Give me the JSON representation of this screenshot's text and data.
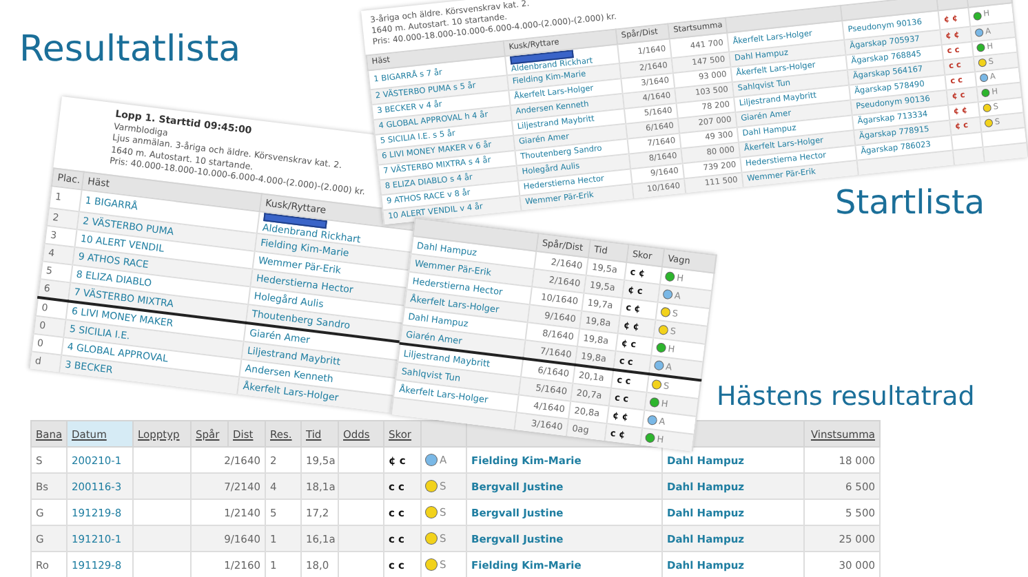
{
  "resultatlista": {
    "title": "Resultatlista",
    "race_title": "Lopp 1. Starttid 09:45:00",
    "details": [
      "Varmblodiga",
      "Ljus anmälan. 3-åriga och äldre. Körsvenskrav kat. 2.",
      "1640 m. Autostart. 10 startande.",
      "Pris: 40.000-18.000-10.000-6.000-4.000-(2.000)-(2.000) kr."
    ],
    "columns": [
      "Plac.",
      "Häst",
      "Kusk/Ryttare"
    ],
    "right_columns": [
      "Spår/Dist",
      "Tid",
      "Skor",
      "Vagn"
    ],
    "rows": [
      {
        "plac": "1",
        "horse": "1 BIGARRÅ",
        "driver": "Aldenbrand Rickhart",
        "marked": true,
        "separator": false,
        "trainer": "Dahl Hampuz",
        "post": "2/1640",
        "time": "19,5a",
        "shoes": "c ¢",
        "cart": {
          "letter": "H",
          "color": "#2db52d"
        }
      },
      {
        "plac": "2",
        "horse": "2 VÄSTERBO PUMA",
        "driver": "Fielding Kim-Marie",
        "marked": false,
        "separator": false,
        "trainer": "Wemmer Pär-Erik",
        "post": "2/1640",
        "time": "19,5a",
        "shoes": "¢ c",
        "cart": {
          "letter": "A",
          "color": "#7ab8e6"
        }
      },
      {
        "plac": "3",
        "horse": "10 ALERT VENDIL",
        "driver": "Wemmer Pär-Erik",
        "marked": false,
        "separator": false,
        "trainer": "Hederstierna Hector",
        "post": "10/1640",
        "time": "19,7a",
        "shoes": "c ¢",
        "cart": {
          "letter": "S",
          "color": "#f2d21b"
        }
      },
      {
        "plac": "4",
        "horse": "9 ATHOS RACE",
        "driver": "Hederstierna Hector",
        "marked": false,
        "separator": false,
        "trainer": "Åkerfelt Lars-Holger",
        "post": "9/1640",
        "time": "19,8a",
        "shoes": "¢ ¢",
        "cart": {
          "letter": "S",
          "color": "#f2d21b"
        }
      },
      {
        "plac": "5",
        "horse": "8 ELIZA DIABLO",
        "driver": "Holegård Aulis",
        "marked": false,
        "separator": false,
        "trainer": "Dahl Hampuz",
        "post": "8/1640",
        "time": "19,8a",
        "shoes": "¢ c",
        "cart": {
          "letter": "H",
          "color": "#2db52d"
        }
      },
      {
        "plac": "6",
        "horse": "7 VÄSTERBO MIXTRA",
        "driver": "Thoutenberg Sandro",
        "marked": false,
        "separator": false,
        "trainer": "Giarén Amer",
        "post": "7/1640",
        "time": "19,8a",
        "shoes": "c c",
        "cart": {
          "letter": "A",
          "color": "#7ab8e6"
        }
      },
      {
        "plac": "0",
        "horse": "6 LIVI MONEY MAKER",
        "driver": "Giarén Amer",
        "marked": false,
        "separator": true,
        "trainer": "Liljestrand Maybritt",
        "post": "6/1640",
        "time": "20,1a",
        "shoes": "c c",
        "cart": {
          "letter": "S",
          "color": "#f2d21b"
        }
      },
      {
        "plac": "0",
        "horse": "5 SICILIA I.E.",
        "driver": "Liljestrand Maybritt",
        "marked": false,
        "separator": false,
        "trainer": "Sahlqvist Tun",
        "post": "5/1640",
        "time": "20,7a",
        "shoes": "c c",
        "cart": {
          "letter": "H",
          "color": "#2db52d"
        }
      },
      {
        "plac": "0",
        "horse": "4 GLOBAL APPROVAL",
        "driver": "Andersen Kenneth",
        "marked": false,
        "separator": false,
        "trainer": "Åkerfelt Lars-Holger",
        "post": "4/1640",
        "time": "20,8a",
        "shoes": "¢ ¢",
        "cart": {
          "letter": "A",
          "color": "#7ab8e6"
        }
      },
      {
        "plac": "d",
        "horse": "3 BECKER",
        "driver": "Åkerfelt Lars-Holger",
        "marked": false,
        "separator": false,
        "post": "3/1640",
        "time": "0ag",
        "shoes": "c ¢",
        "cart": {
          "letter": "H",
          "color": "#2db52d"
        }
      }
    ]
  },
  "startlista": {
    "title": "Startlista",
    "details": [
      "3-åriga och äldre. Körsvenskrav kat. 2.",
      "1640 m. Autostart. 10 startande.",
      "Pris: 40.000-18.000-10.000-6.000-4.000-(2.000)-(2.000) kr."
    ],
    "columns": [
      "Häst",
      "Kusk/Ryttare",
      "Spår/Dist",
      "Startsumma"
    ],
    "rows": [
      {
        "horse": "1 BIGARRÅ s 7 år",
        "driver": "Aldenbrand Rickhart",
        "marked": true,
        "post": "1/1640",
        "sum": "441 700",
        "trainer": "Åkerfelt Lars-Holger",
        "owner": "Pseudonym 90136",
        "shoes": "¢ ¢",
        "cart": {
          "letter": "H",
          "color": "#2db52d"
        }
      },
      {
        "horse": "2 VÄSTERBO PUMA s 5 år",
        "driver": "Fielding Kim-Marie",
        "marked": false,
        "post": "2/1640",
        "sum": "147 500",
        "trainer": "Dahl Hampuz",
        "owner": "Ägarskap 705937",
        "shoes": "¢ ¢",
        "cart": {
          "letter": "A",
          "color": "#7ab8e6"
        }
      },
      {
        "horse": "3 BECKER v 4 år",
        "driver": "Åkerfelt Lars-Holger",
        "marked": false,
        "post": "3/1640",
        "sum": "93 000",
        "trainer": "Åkerfelt Lars-Holger",
        "owner": "Ägarskap 768845",
        "shoes": "c c",
        "cart": {
          "letter": "H",
          "color": "#2db52d"
        }
      },
      {
        "horse": "4 GLOBAL APPROVAL h 4 år",
        "driver": "Andersen Kenneth",
        "marked": false,
        "post": "4/1640",
        "sum": "103 500",
        "trainer": "Sahlqvist Tun",
        "owner": "Ägarskap 564167",
        "shoes": "c c",
        "cart": {
          "letter": "S",
          "color": "#f2d21b"
        }
      },
      {
        "horse": "5 SICILIA I.E. s 5 år",
        "driver": "Liljestrand Maybritt",
        "marked": false,
        "post": "5/1640",
        "sum": "78 200",
        "trainer": "Liljestrand Maybritt",
        "owner": "Ägarskap 578490",
        "shoes": "c c",
        "cart": {
          "letter": "A",
          "color": "#7ab8e6"
        }
      },
      {
        "horse": "6 LIVI MONEY MAKER v 6 år",
        "driver": "Giarén Amer",
        "marked": false,
        "post": "6/1640",
        "sum": "207 000",
        "trainer": "Giarén Amer",
        "owner": "Pseudonym 90136",
        "shoes": "¢ c",
        "cart": {
          "letter": "H",
          "color": "#2db52d"
        }
      },
      {
        "horse": "7 VÄSTERBO MIXTRA s 4 år",
        "driver": "Thoutenberg Sandro",
        "marked": false,
        "post": "7/1640",
        "sum": "49 300",
        "trainer": "Dahl Hampuz",
        "owner": "Ägarskap 713334",
        "shoes": "¢ ¢",
        "cart": {
          "letter": "S",
          "color": "#f2d21b"
        }
      },
      {
        "horse": "8 ELIZA DIABLO s 4 år",
        "driver": "Holegård Aulis",
        "marked": false,
        "post": "8/1640",
        "sum": "80 000",
        "trainer": "Åkerfelt Lars-Holger",
        "owner": "Ägarskap 778915",
        "shoes": "¢ c",
        "cart": {
          "letter": "S",
          "color": "#f2d21b"
        }
      },
      {
        "horse": "9 ATHOS RACE v 8 år",
        "driver": "Hederstierna Hector",
        "marked": false,
        "post": "9/1640",
        "sum": "739 200",
        "trainer": "Hederstierna Hector",
        "owner": "Ägarskap 786023"
      },
      {
        "horse": "10 ALERT VENDIL v 4 år",
        "driver": "Wemmer Pär-Erik",
        "marked": false,
        "post": "10/1640",
        "sum": "111 500",
        "trainer": "Wemmer Pär-Erik"
      }
    ]
  },
  "resultatrad": {
    "title": "Hästens resultatrad",
    "columns": [
      {
        "label": "Bana",
        "selected": false
      },
      {
        "label": "Datum",
        "selected": true
      },
      {
        "label": "Lopptyp",
        "selected": false
      },
      {
        "label": "Spår",
        "selected": false
      },
      {
        "label": "Dist",
        "selected": false
      },
      {
        "label": "Res.",
        "selected": false
      },
      {
        "label": "Tid",
        "selected": false
      },
      {
        "label": "Odds",
        "selected": false
      },
      {
        "label": "Skor",
        "selected": false
      }
    ],
    "last_column": {
      "label": "Vinstsumma",
      "selected": false
    },
    "rows": [
      {
        "track": "S",
        "date": "200210-1",
        "post": "2/1640",
        "result": "2",
        "time": "19,5a",
        "shoes": "¢ c",
        "cart": {
          "letter": "A",
          "color": "#7ab8e6"
        },
        "driver": "Fielding Kim-Marie",
        "trainer": "Dahl Hampuz",
        "prize": "18 000"
      },
      {
        "track": "Bs",
        "date": "200116-3",
        "post": "7/2140",
        "result": "4",
        "time": "18,1a",
        "shoes": "c c",
        "cart": {
          "letter": "S",
          "color": "#f2d21b"
        },
        "driver": "Bergvall Justine",
        "trainer": "Dahl Hampuz",
        "prize": "6 500"
      },
      {
        "track": "G",
        "date": "191219-8",
        "post": "1/2140",
        "result": "5",
        "time": "17,2",
        "shoes": "c c",
        "cart": {
          "letter": "S",
          "color": "#f2d21b"
        },
        "driver": "Bergvall Justine",
        "trainer": "Dahl Hampuz",
        "prize": "5 500"
      },
      {
        "track": "G",
        "date": "191210-1",
        "post": "9/1640",
        "result": "1",
        "time": "16,1a",
        "shoes": "c c",
        "cart": {
          "letter": "S",
          "color": "#f2d21b"
        },
        "driver": "Bergvall Justine",
        "trainer": "Dahl Hampuz",
        "prize": "25 000"
      },
      {
        "track": "Ro",
        "date": "191129-8",
        "post": "1/2160",
        "result": "1",
        "time": "18,0",
        "shoes": "c c",
        "cart": {
          "letter": "S",
          "color": "#f2d21b"
        },
        "driver": "Fielding Kim-Marie",
        "trainer": "Dahl Hampuz",
        "prize": "30 000"
      }
    ]
  }
}
